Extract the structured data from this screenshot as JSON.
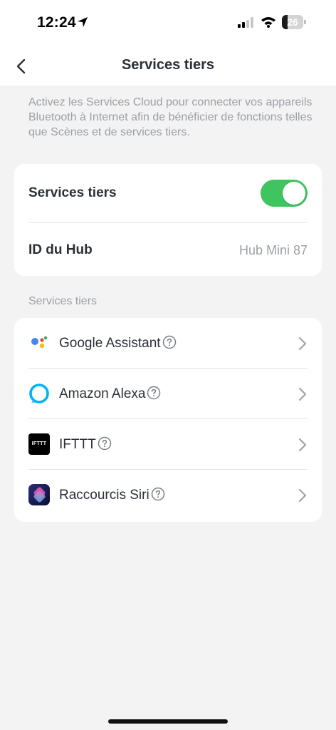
{
  "status_bar": {
    "time": "12:24",
    "battery_level": "26",
    "battery_fraction": 0.26
  },
  "nav": {
    "title": "Services tiers",
    "back_icon": "chevron-left-icon"
  },
  "description": "Activez les Services Cloud pour connecter vos appareils Bluetooth à Internet afin de bénéficier de fonctions telles que Scènes et de services tiers.",
  "main_card": {
    "toggle_label": "Services tiers",
    "toggle_on": true,
    "hub_label": "ID du Hub",
    "hub_value": "Hub Mini 87"
  },
  "section_header": "Services tiers",
  "services": [
    {
      "label": "Google Assistant",
      "icon": "google-assistant-icon"
    },
    {
      "label": "Amazon Alexa",
      "icon": "alexa-icon"
    },
    {
      "label": "IFTTT",
      "icon": "ifttt-icon",
      "icon_text": "IFTTT"
    },
    {
      "label": "Raccourcis Siri",
      "icon": "siri-shortcuts-icon"
    }
  ],
  "colors": {
    "toggle_on": "#3fc560",
    "background": "#f3f3f4",
    "card": "#ffffff",
    "secondary_text": "#9c9fa5",
    "primary_text": "#2b2f36"
  }
}
